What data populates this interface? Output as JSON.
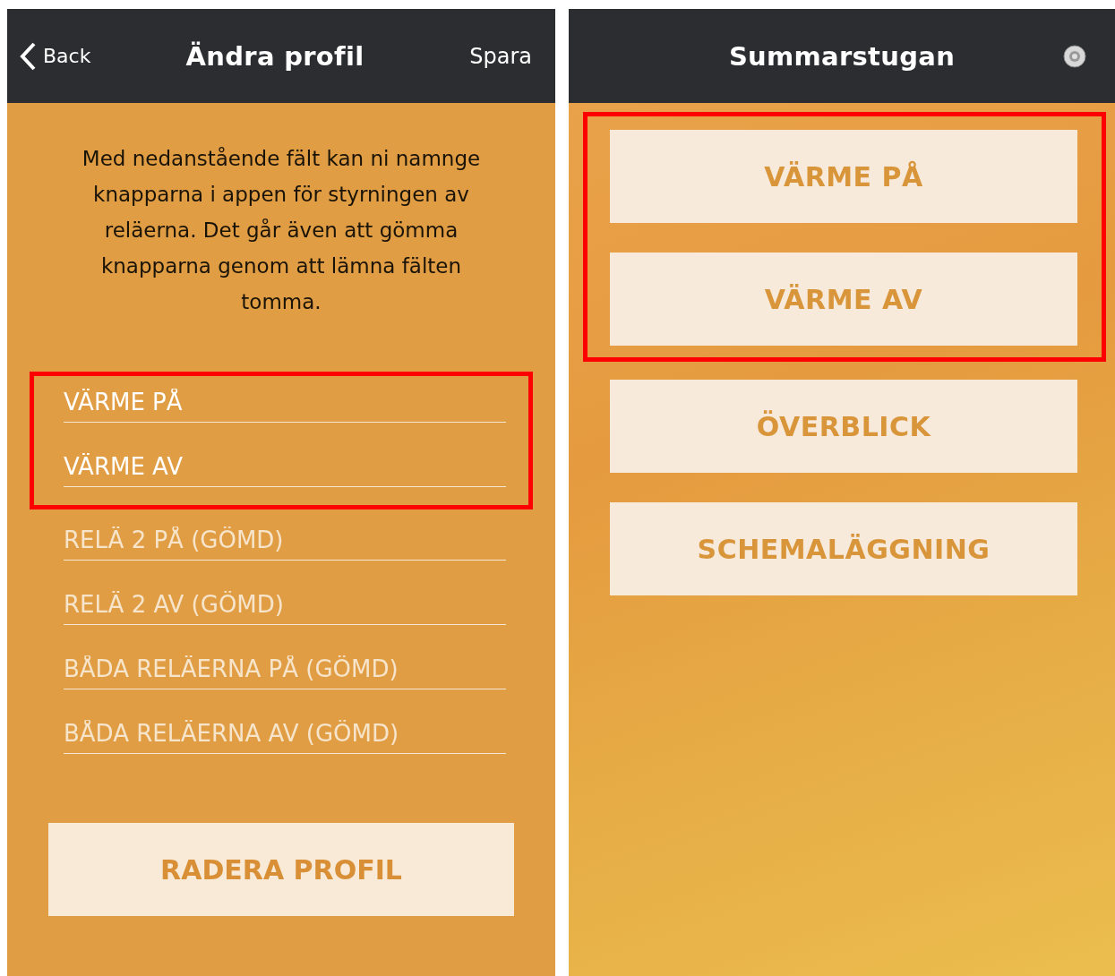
{
  "edit_screen": {
    "back": "Back",
    "title": "Ändra profil",
    "save": "Spara",
    "intro": "Med nedanstående fält kan ni namnge knapparna i appen för styrningen av reläerna. Det går även att gömma knapparna genom att lämna fälten tomma.",
    "fields": [
      {
        "value": "VÄRME PÅ",
        "highlighted": true
      },
      {
        "value": "VÄRME AV",
        "highlighted": true
      },
      {
        "placeholder": "RELÄ 2 PÅ (GÖMD)",
        "highlighted": false
      },
      {
        "placeholder": "RELÄ 2 AV (GÖMD)",
        "highlighted": false
      },
      {
        "placeholder": "BÅDA RELÄERNA PÅ (GÖMD)",
        "highlighted": false
      },
      {
        "placeholder": "BÅDA RELÄERNA AV (GÖMD)",
        "highlighted": false
      }
    ],
    "delete_button": "RADERA PROFIL"
  },
  "home_screen": {
    "title": "Summarstugan",
    "buttons": [
      {
        "label": "VÄRME PÅ",
        "highlighted": true
      },
      {
        "label": "VÄRME AV",
        "highlighted": true
      },
      {
        "label": "ÖVERBLICK",
        "highlighted": false
      },
      {
        "label": "SCHEMALÄGGNING",
        "highlighted": false
      }
    ]
  }
}
